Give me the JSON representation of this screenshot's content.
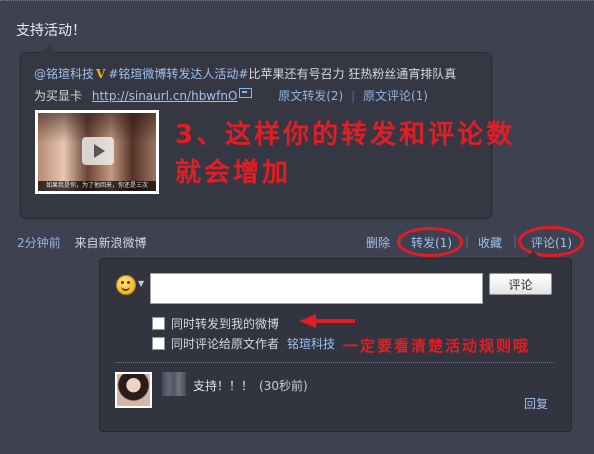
{
  "post": {
    "text": "支持活动！"
  },
  "quote": {
    "author": "@铭瑄科技",
    "badge": "V",
    "hashtag": "#铭瑄微博转发达人活动#",
    "text": "比苹果还有号召力 狂热粉丝通宵排队真",
    "text2": "为买显卡",
    "url": "http://sinaurl.cn/hbwfnO",
    "forward_label": "原文转发(2)",
    "comment_label": "原文评论(1)",
    "thumb_caption": "如果我是你，为了他回来，你还是三次"
  },
  "annotations": {
    "line1": "3、这样你的转发和评论数",
    "line2": "就会增加",
    "line3": "一定要看清楚活动规则哦"
  },
  "meta": {
    "time": "2分钟前",
    "source": "来自新浪微博",
    "delete": "删除",
    "forward": "转发(1)",
    "favorite": "收藏",
    "comment": "评论(1)",
    "separator": "|"
  },
  "comment_box": {
    "input_value": "",
    "submit_label": "评论",
    "option_forward": "同时转发到我的微博",
    "option_comment_author": "同时评论给原文作者",
    "author_name": "铭瑄科技"
  },
  "comments": [
    {
      "text": "支持！！！",
      "time": "(30秒前)",
      "reply_label": "回复"
    }
  ],
  "colors": {
    "background": "#3e4250",
    "link": "#8fb4e6",
    "annotation_red": "#e31d25"
  }
}
